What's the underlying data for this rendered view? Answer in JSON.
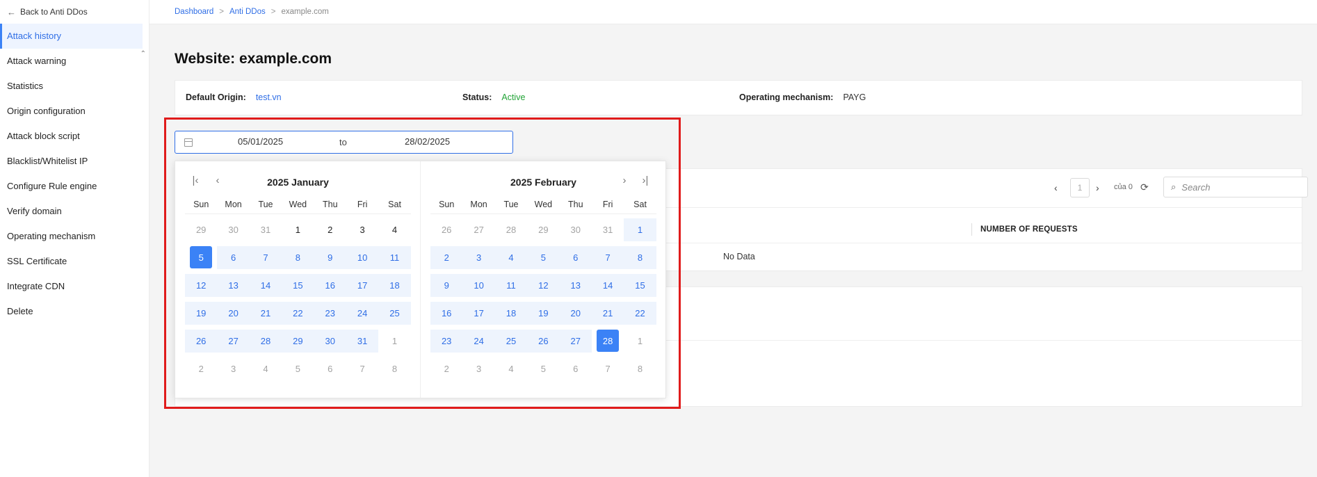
{
  "sidebar": {
    "back_label": "Back to Anti DDos",
    "items": [
      {
        "label": "Attack history",
        "active": true
      },
      {
        "label": "Attack warning"
      },
      {
        "label": "Statistics"
      },
      {
        "label": "Origin configuration"
      },
      {
        "label": "Attack block script"
      },
      {
        "label": "Blacklist/Whitelist IP"
      },
      {
        "label": "Configure Rule engine"
      },
      {
        "label": "Verify domain"
      },
      {
        "label": "Operating mechanism"
      },
      {
        "label": "SSL Certificate"
      },
      {
        "label": "Integrate CDN"
      },
      {
        "label": "Delete"
      }
    ]
  },
  "breadcrumb": {
    "items": [
      "Dashboard",
      "Anti DDos"
    ],
    "separator": ">",
    "current": "example.com"
  },
  "page": {
    "title": "Website: example.com"
  },
  "info": {
    "origin_label": "Default Origin:",
    "origin_value": "test.vn",
    "status_label": "Status:",
    "status_value": "Active",
    "mechanism_label": "Operating mechanism:",
    "mechanism_value": "PAYG"
  },
  "table": {
    "page_prev": "‹",
    "page_number": "1",
    "page_next": "›",
    "page_of": "của 0",
    "search_placeholder": "Search",
    "col_requests": "NUMBER OF REQUESTS",
    "no_data": "No Data"
  },
  "range": {
    "start": "05/01/2025",
    "to": "to",
    "end": "28/02/2025"
  },
  "calendar": {
    "weekdays": [
      "Sun",
      "Mon",
      "Tue",
      "Wed",
      "Thu",
      "Fri",
      "Sat"
    ],
    "nav": {
      "super_prev": "|‹",
      "prev": "‹",
      "next": "›",
      "super_next": "›|"
    },
    "left": {
      "title": "2025 January",
      "weeks": [
        [
          {
            "d": "29",
            "s": "out"
          },
          {
            "d": "30",
            "s": "out"
          },
          {
            "d": "31",
            "s": "out"
          },
          {
            "d": "1",
            "s": "norm"
          },
          {
            "d": "2",
            "s": "norm"
          },
          {
            "d": "3",
            "s": "norm"
          },
          {
            "d": "4",
            "s": "norm"
          }
        ],
        [
          {
            "d": "5",
            "s": "sel"
          },
          {
            "d": "6",
            "s": "inrange"
          },
          {
            "d": "7",
            "s": "inrange"
          },
          {
            "d": "8",
            "s": "inrange"
          },
          {
            "d": "9",
            "s": "inrange"
          },
          {
            "d": "10",
            "s": "inrange"
          },
          {
            "d": "11",
            "s": "inrange"
          }
        ],
        [
          {
            "d": "12",
            "s": "inrange"
          },
          {
            "d": "13",
            "s": "inrange"
          },
          {
            "d": "14",
            "s": "inrange"
          },
          {
            "d": "15",
            "s": "inrange"
          },
          {
            "d": "16",
            "s": "inrange"
          },
          {
            "d": "17",
            "s": "inrange"
          },
          {
            "d": "18",
            "s": "inrange"
          }
        ],
        [
          {
            "d": "19",
            "s": "inrange"
          },
          {
            "d": "20",
            "s": "inrange"
          },
          {
            "d": "21",
            "s": "inrange"
          },
          {
            "d": "22",
            "s": "inrange"
          },
          {
            "d": "23",
            "s": "inrange"
          },
          {
            "d": "24",
            "s": "inrange"
          },
          {
            "d": "25",
            "s": "inrange"
          }
        ],
        [
          {
            "d": "26",
            "s": "inrange"
          },
          {
            "d": "27",
            "s": "inrange"
          },
          {
            "d": "28",
            "s": "inrange"
          },
          {
            "d": "29",
            "s": "inrange"
          },
          {
            "d": "30",
            "s": "inrange"
          },
          {
            "d": "31",
            "s": "inrange"
          },
          {
            "d": "1",
            "s": "out"
          }
        ],
        [
          {
            "d": "2",
            "s": "out"
          },
          {
            "d": "3",
            "s": "out"
          },
          {
            "d": "4",
            "s": "out"
          },
          {
            "d": "5",
            "s": "out"
          },
          {
            "d": "6",
            "s": "out"
          },
          {
            "d": "7",
            "s": "out"
          },
          {
            "d": "8",
            "s": "out"
          }
        ]
      ]
    },
    "right": {
      "title": "2025 February",
      "weeks": [
        [
          {
            "d": "26",
            "s": "out"
          },
          {
            "d": "27",
            "s": "out"
          },
          {
            "d": "28",
            "s": "out"
          },
          {
            "d": "29",
            "s": "out"
          },
          {
            "d": "30",
            "s": "out"
          },
          {
            "d": "31",
            "s": "out"
          },
          {
            "d": "1",
            "s": "inrange"
          }
        ],
        [
          {
            "d": "2",
            "s": "inrange"
          },
          {
            "d": "3",
            "s": "inrange"
          },
          {
            "d": "4",
            "s": "inrange"
          },
          {
            "d": "5",
            "s": "inrange"
          },
          {
            "d": "6",
            "s": "inrange"
          },
          {
            "d": "7",
            "s": "inrange"
          },
          {
            "d": "8",
            "s": "inrange"
          }
        ],
        [
          {
            "d": "9",
            "s": "inrange"
          },
          {
            "d": "10",
            "s": "inrange"
          },
          {
            "d": "11",
            "s": "inrange"
          },
          {
            "d": "12",
            "s": "inrange"
          },
          {
            "d": "13",
            "s": "inrange"
          },
          {
            "d": "14",
            "s": "inrange"
          },
          {
            "d": "15",
            "s": "inrange"
          }
        ],
        [
          {
            "d": "16",
            "s": "inrange"
          },
          {
            "d": "17",
            "s": "inrange"
          },
          {
            "d": "18",
            "s": "inrange"
          },
          {
            "d": "19",
            "s": "inrange"
          },
          {
            "d": "20",
            "s": "inrange"
          },
          {
            "d": "21",
            "s": "inrange"
          },
          {
            "d": "22",
            "s": "inrange"
          }
        ],
        [
          {
            "d": "23",
            "s": "inrange"
          },
          {
            "d": "24",
            "s": "inrange"
          },
          {
            "d": "25",
            "s": "inrange"
          },
          {
            "d": "26",
            "s": "inrange"
          },
          {
            "d": "27",
            "s": "inrange"
          },
          {
            "d": "28",
            "s": "sel"
          },
          {
            "d": "1",
            "s": "out"
          }
        ],
        [
          {
            "d": "2",
            "s": "out"
          },
          {
            "d": "3",
            "s": "out"
          },
          {
            "d": "4",
            "s": "out"
          },
          {
            "d": "5",
            "s": "out"
          },
          {
            "d": "6",
            "s": "out"
          },
          {
            "d": "7",
            "s": "out"
          },
          {
            "d": "8",
            "s": "out"
          }
        ]
      ]
    }
  },
  "colors": {
    "accent": "#3b82f6",
    "link": "#2f6ee6",
    "active_status": "#21a336",
    "highlight_frame": "#e01b1b",
    "range_bg": "#eef4fd"
  }
}
